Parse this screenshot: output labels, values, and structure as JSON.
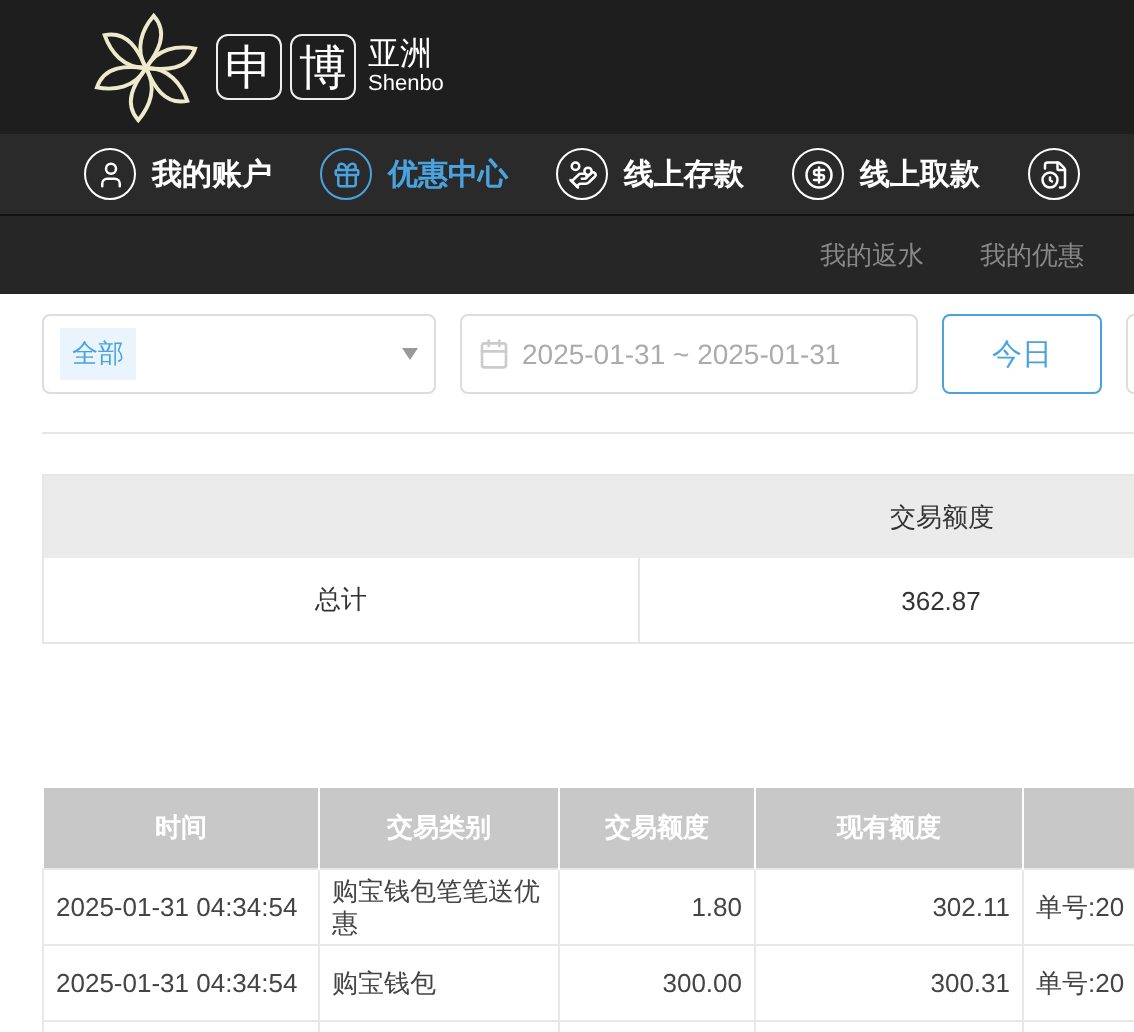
{
  "logo": {
    "boxed": [
      "申",
      "博"
    ],
    "name": "亚洲",
    "latin": "Shenbo"
  },
  "nav": [
    {
      "label": "我的账户",
      "selected": false
    },
    {
      "label": "优惠中心",
      "selected": true
    },
    {
      "label": "线上存款",
      "selected": false
    },
    {
      "label": "线上取款",
      "selected": false
    },
    {
      "selected": false
    }
  ],
  "subnav": [
    "我的返水",
    "我的优惠"
  ],
  "filter": {
    "type_tag": "全部",
    "date_range": "2025-01-31 ~ 2025-01-31",
    "buttons": [
      {
        "label": "今日",
        "selected": true
      },
      {
        "selected": false
      }
    ]
  },
  "summary": {
    "header": "交易额度",
    "row": [
      "总计",
      "362.87"
    ]
  },
  "table": {
    "columns": [
      "时间",
      "交易类别",
      "交易额度",
      "现有额度",
      ""
    ],
    "rows": [
      [
        "2025-01-31 04:34:54",
        "购宝钱包笔笔送优惠",
        "1.80",
        "302.11",
        "单号:20"
      ],
      [
        "2025-01-31 04:34:54",
        "购宝钱包",
        "300.00",
        "300.31",
        "单号:20"
      ],
      [
        "",
        "",
        "",
        "",
        ""
      ]
    ]
  }
}
